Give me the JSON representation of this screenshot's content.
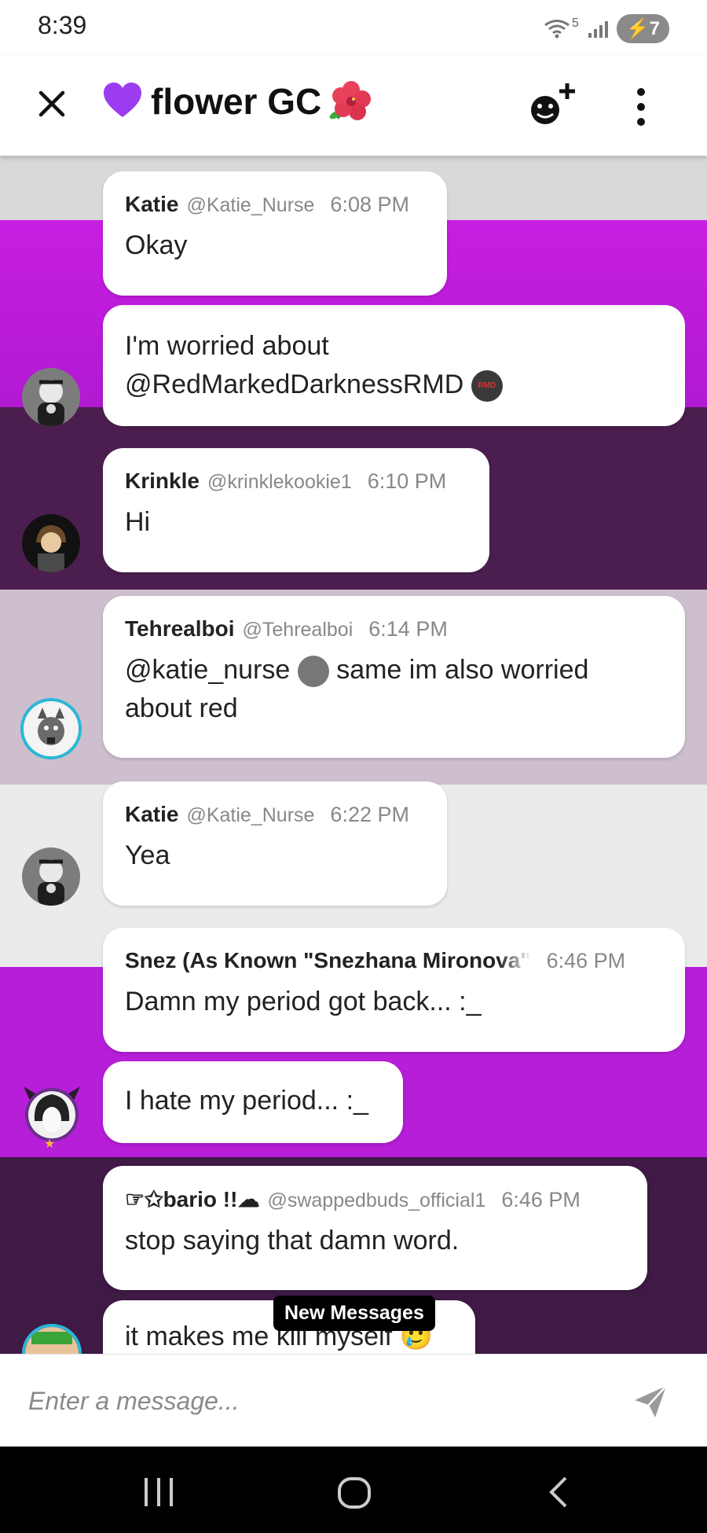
{
  "status": {
    "time": "8:39",
    "wifi_label": "5",
    "battery": "7"
  },
  "header": {
    "title": "flower GC"
  },
  "messages": [
    {
      "name": "Katie",
      "handle": "@Katie_Nurse",
      "time": "6:08 PM",
      "text": "Okay"
    },
    {
      "text_line1": "I'm worried about",
      "text_line2": "@RedMarkedDarknessRMD",
      "badge": "RMD"
    },
    {
      "name": "Krinkle",
      "handle": "@krinklekookie1",
      "time": "6:10 PM",
      "text": "Hi"
    },
    {
      "name": "Tehrealboi",
      "handle": "@Tehrealboi",
      "time": "6:14 PM",
      "text_a": "@katie_nurse",
      "text_b": " same im also worried",
      "text_c": "about red"
    },
    {
      "name": "Katie",
      "handle": "@Katie_Nurse",
      "time": "6:22 PM",
      "text": "Yea"
    },
    {
      "name": "Snez (As Known \"Snezhana Mironova\"",
      "time": "6:46 PM",
      "text": "Damn my period got back... :_"
    },
    {
      "text": "I hate my period... :_"
    },
    {
      "name": "☞✩bario !!☁",
      "handle": "@swappedbuds_official1",
      "time": "6:46 PM",
      "text": "stop saying that damn word."
    },
    {
      "text": "it makes me kill myself 🥲"
    }
  ],
  "new_messages_label": "New Messages",
  "composer": {
    "placeholder": "Enter a message..."
  },
  "colors": {
    "accent_purple": "#b11ad2",
    "dark_purple": "#4c1e4f",
    "heart": "#9b3cf0"
  }
}
